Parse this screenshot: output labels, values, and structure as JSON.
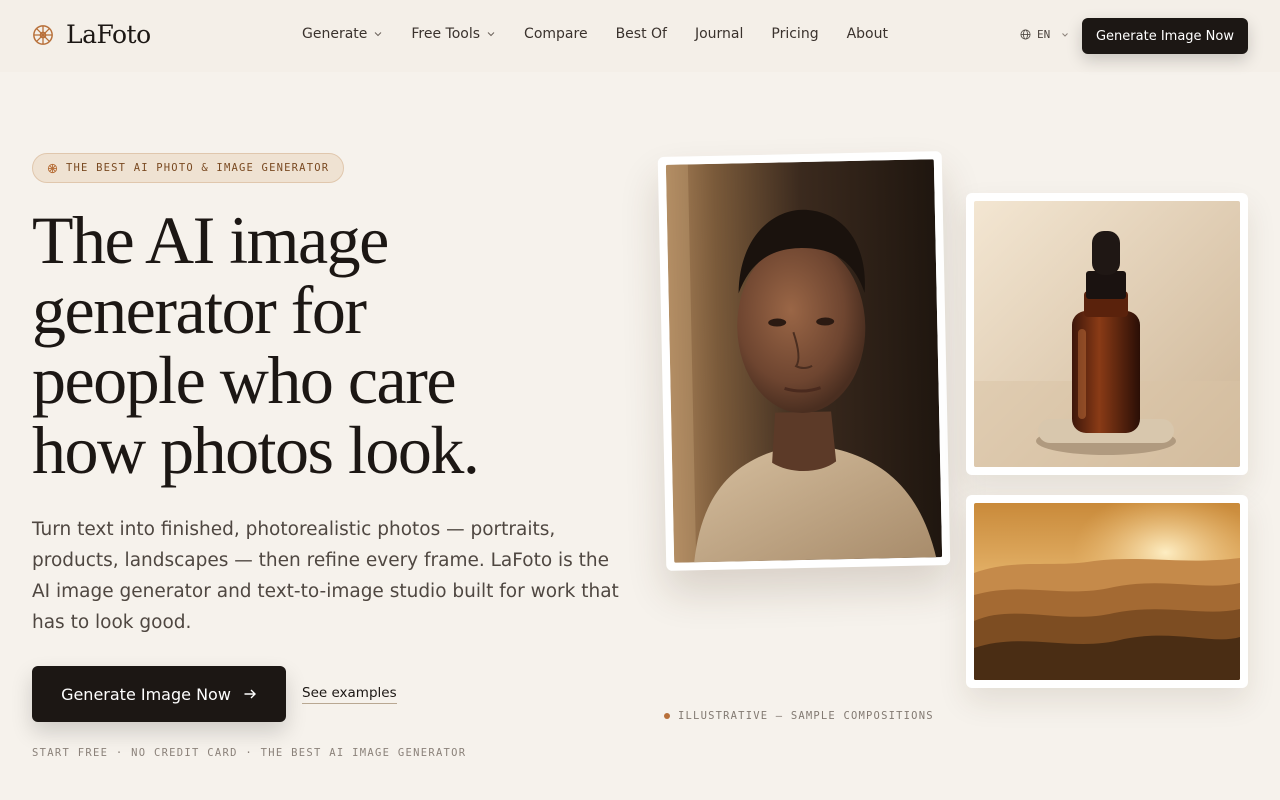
{
  "brand": {
    "name": "LaFoto",
    "accent": "#b8703a"
  },
  "nav": {
    "items": [
      {
        "label": "Generate",
        "dropdown": true
      },
      {
        "label": "Free Tools",
        "dropdown": true
      },
      {
        "label": "Compare",
        "dropdown": false
      },
      {
        "label": "Best Of",
        "dropdown": false
      },
      {
        "label": "Journal",
        "dropdown": false
      },
      {
        "label": "Pricing",
        "dropdown": false
      },
      {
        "label": "About",
        "dropdown": false
      }
    ],
    "language": "EN",
    "cta_label": "Generate Image Now"
  },
  "hero": {
    "badge": "THE BEST AI PHOTO & IMAGE GENERATOR",
    "headline_lines": [
      "The AI image",
      "generator for",
      "people who care",
      "how photos look."
    ],
    "lede": "Turn text into finished, photorealistic photos — portraits, products, landscapes — then refine every frame. LaFoto is the AI image generator and text-to-image studio built for work that has to look good.",
    "cta_label": "Generate Image Now",
    "secondary_label": "See examples",
    "fineprint": "START FREE · NO CREDIT CARD · THE BEST AI IMAGE GENERATOR"
  },
  "gallery": {
    "caption": "ILLUSTRATIVE — SAMPLE COMPOSITIONS"
  }
}
